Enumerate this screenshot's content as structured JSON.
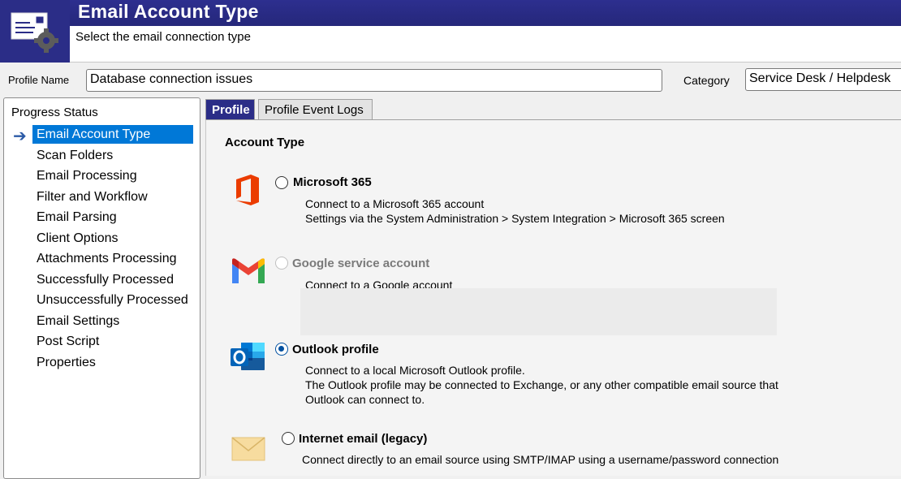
{
  "header": {
    "title": "Email Account Type",
    "subtitle": "Select the email connection type",
    "icon": "email-settings-icon"
  },
  "profile": {
    "name_label": "Profile Name",
    "name_value": "Database connection issues",
    "category_label": "Category",
    "category_value": "Service Desk / Helpdesk"
  },
  "progress": {
    "title": "Progress Status",
    "items": [
      "Email Account Type",
      "Scan Folders",
      "Email Processing",
      "Filter and Workflow",
      "Email Parsing",
      "Client Options",
      "Attachments Processing",
      "Successfully Processed",
      "Unsuccessfully Processed",
      "Email Settings",
      "Post Script",
      "Properties"
    ],
    "selected_index": 0
  },
  "tabs": [
    {
      "label": "Profile",
      "active": true
    },
    {
      "label": "Profile Event Logs",
      "active": false
    }
  ],
  "account_type": {
    "title": "Account Type",
    "options": [
      {
        "label": "Microsoft 365",
        "icon": "microsoft-office-icon",
        "enabled": true,
        "checked": false,
        "desc": [
          "Connect to a Microsoft 365 account",
          "Settings via the System Administration > System Integration > Microsoft 365 screen"
        ]
      },
      {
        "label": "Google service account",
        "icon": "gmail-icon",
        "enabled": false,
        "checked": false,
        "desc": [
          "Connect to a Google account"
        ]
      },
      {
        "label": "Outlook profile",
        "icon": "outlook-icon",
        "enabled": true,
        "checked": true,
        "desc": [
          "Connect to a local Microsoft Outlook profile.",
          "The Outlook profile may be connected to Exchange, or any other compatible email source that",
          "Outlook can connect to."
        ]
      },
      {
        "label": "Internet email (legacy)",
        "icon": "envelope-icon",
        "enabled": true,
        "checked": false,
        "desc": [
          "Connect directly to an email source using SMTP/IMAP using a username/password connection"
        ]
      }
    ]
  },
  "colors": {
    "header_band": "#2b2d87",
    "selection": "#0078d7",
    "office_orange": "#eb3c00",
    "outlook_blue": "#0364b8"
  }
}
